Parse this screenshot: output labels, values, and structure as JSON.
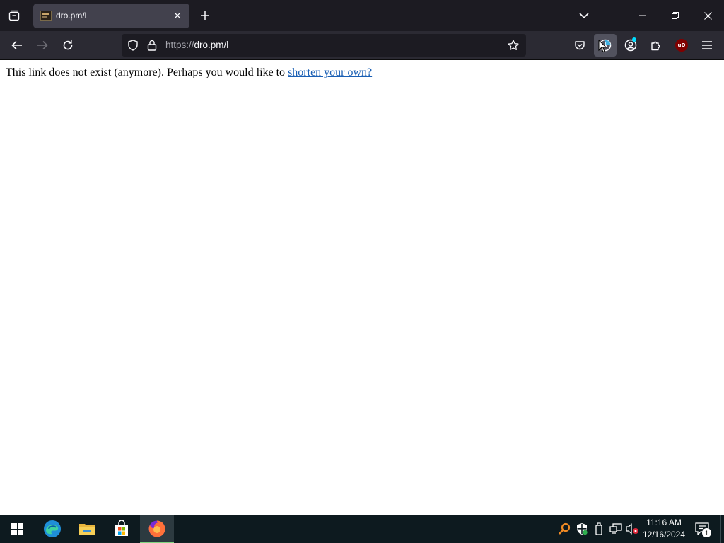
{
  "browser": {
    "tab": {
      "title": "dro.pm/l"
    },
    "urlbar": {
      "scheme": "https://",
      "host_path": "dro.pm/l"
    }
  },
  "page": {
    "message": "This link does not exist (anymore). Perhaps you would like to ",
    "link_text": "shorten your own?"
  },
  "taskbar": {
    "clock": {
      "time": "11:16 AM",
      "date": "12/16/2024"
    },
    "notification_count": "1"
  },
  "colors": {
    "tabstrip_bg": "#1c1b22",
    "toolbar_bg": "#2b2a33",
    "taskbar_bg": "#0d1a1f",
    "link": "#1a5fb4",
    "ublock_red": "#800000",
    "ublock_label": "uO"
  },
  "icons": [
    "tab-list-icon",
    "site-favicon",
    "close-icon",
    "plus-icon",
    "chevron-down-icon",
    "minimize-icon",
    "restore-icon",
    "window-close-icon",
    "back-arrow-icon",
    "forward-arrow-icon",
    "reload-icon",
    "shield-icon",
    "lock-icon",
    "star-icon",
    "pocket-icon",
    "history-extension-icon",
    "account-icon",
    "extensions-icon",
    "ublock-icon",
    "hamburger-menu-icon",
    "windows-start-icon",
    "edge-icon",
    "file-explorer-icon",
    "store-icon",
    "firefox-icon",
    "search-tray-icon",
    "security-shield-tray-icon",
    "usb-tray-icon",
    "network-tray-icon",
    "volume-muted-tray-icon",
    "notification-icon"
  ]
}
